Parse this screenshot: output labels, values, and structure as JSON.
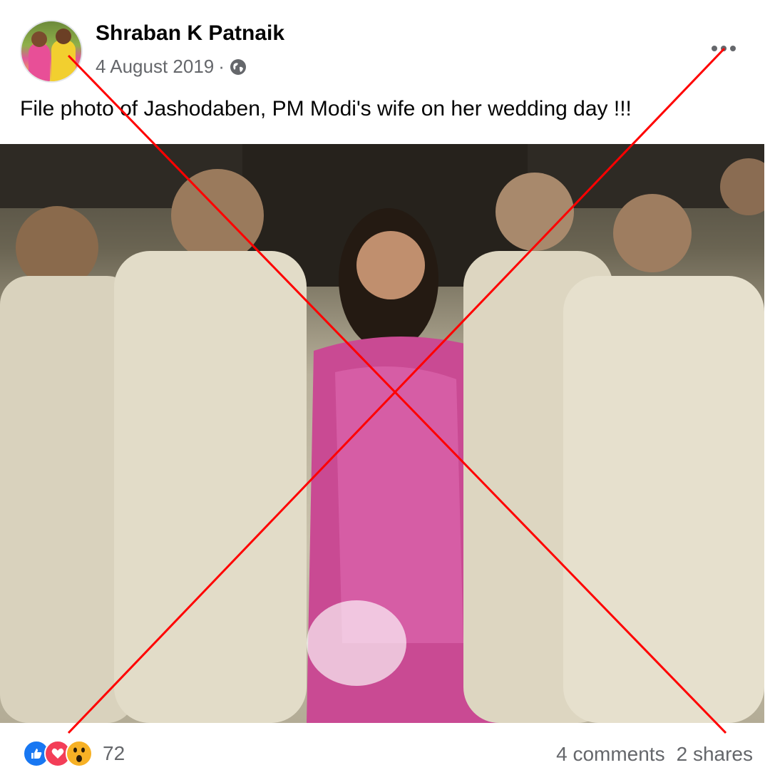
{
  "post": {
    "author": "Shraban K Patnaik",
    "date": "4 August 2019",
    "date_separator": "·",
    "privacy_icon": "globe-icon",
    "caption": "File photo of Jashodaben, PM Modi's wife on her wedding day !!!",
    "more_icon": "more-options-icon"
  },
  "reactions": {
    "icons": [
      "like-icon",
      "love-icon",
      "wow-icon"
    ],
    "count": "72"
  },
  "stats": {
    "comments": "4 comments",
    "shares": "2 shares"
  },
  "overlay": {
    "mark": "red-cross-icon",
    "color": "#ff0000"
  },
  "colors": {
    "primary_text": "#050505",
    "secondary_text": "#65676b",
    "like_blue": "#1877f2",
    "love_red": "#f33e58",
    "wow_yellow": "#f7b125",
    "saree_pink": "#d44a9a"
  }
}
